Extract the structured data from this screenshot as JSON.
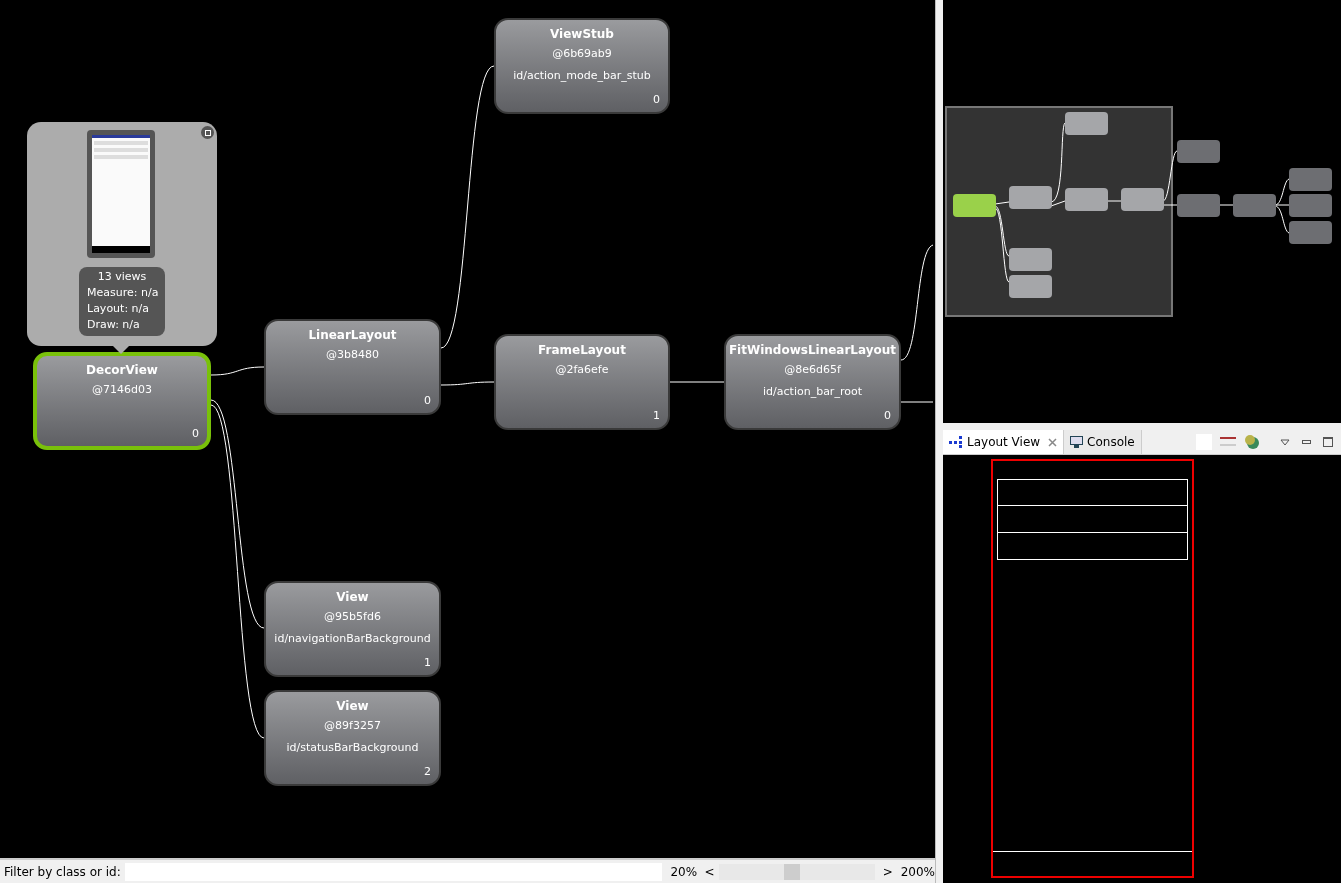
{
  "nodes": [
    {
      "name": "ViewStub",
      "hash": "@6b69ab9",
      "view_id": "id/action_mode_bar_stub",
      "index": "0",
      "selected": false
    },
    {
      "name": "DecorView",
      "hash": "@7146d03",
      "index": "0",
      "selected": true
    },
    {
      "name": "LinearLayout",
      "hash": "@3b8480",
      "index": "0",
      "selected": false
    },
    {
      "name": "FrameLayout",
      "hash": "@2fa6efe",
      "index": "1",
      "selected": false
    },
    {
      "name": "FitWindowsLinearLayout",
      "hash": "@8e6d65f",
      "view_id": "id/action_bar_root",
      "index": "0",
      "selected": false
    },
    {
      "name": "View",
      "hash": "@95b5fd6",
      "view_id": "id/navigationBarBackground",
      "index": "1",
      "selected": false
    },
    {
      "name": "View",
      "hash": "@89f3257",
      "view_id": "id/statusBarBackground",
      "index": "2",
      "selected": false
    }
  ],
  "tooltip": {
    "lines": [
      "13 views",
      "Measure: n/a",
      "Layout: n/a",
      "Draw: n/a"
    ]
  },
  "filter": {
    "label": "Filter by class or id:"
  },
  "zoom": {
    "min": "20%",
    "left_arrow": "<",
    "right_arrow": ">",
    "max": "200%",
    "level": 0.47
  },
  "tabs": [
    {
      "label": "Layout View",
      "selected": true
    },
    {
      "label": "Console",
      "selected": false
    }
  ]
}
